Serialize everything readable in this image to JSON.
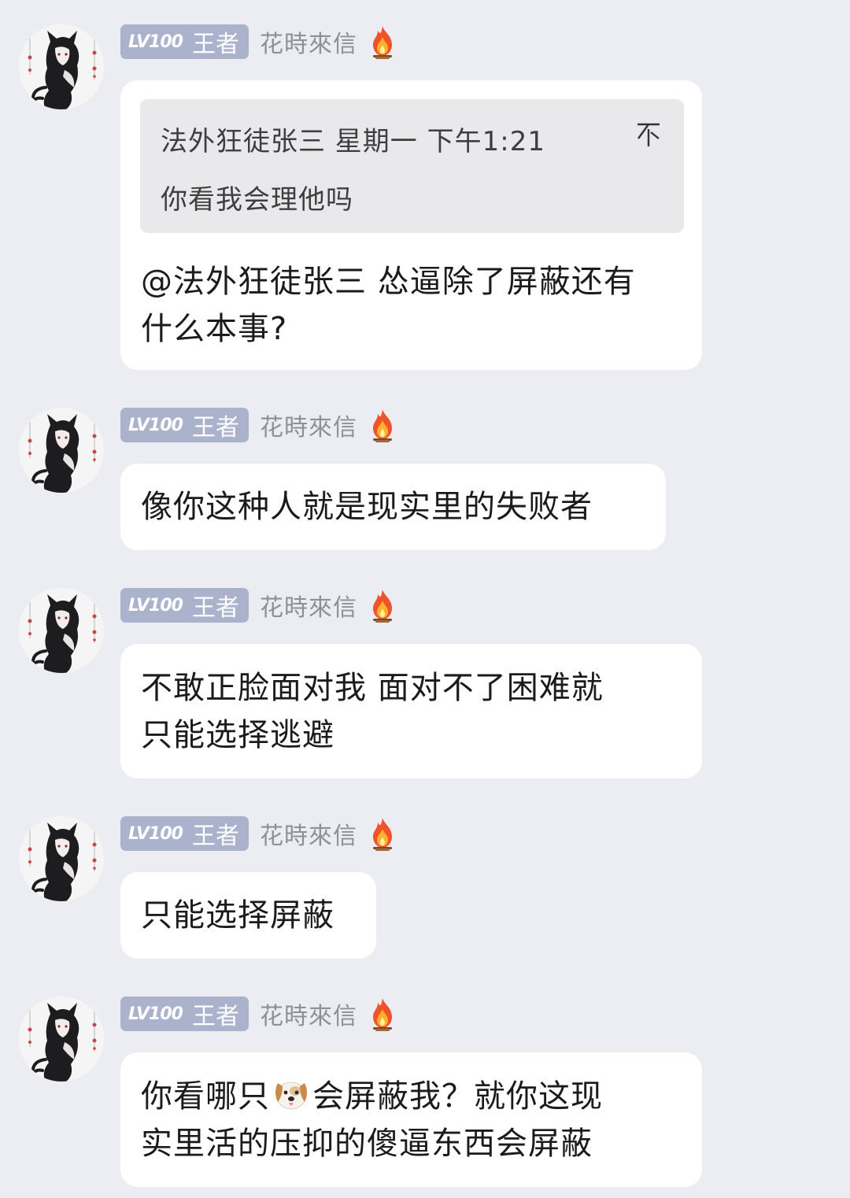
{
  "sender": {
    "level": "LV100",
    "title": "王者",
    "name": "花時來信",
    "avatar_icon": "anime-cat-girl-avatar",
    "flame_icon": "flame-icon"
  },
  "colors": {
    "background": "#ecedf2",
    "badge": "#aab2cc",
    "bubble": "#ffffff",
    "quote_bg": "#e9e9eb",
    "username": "#8f8f96"
  },
  "messages": [
    {
      "quote": {
        "header": "法外狂徒张三 星期一 下午1:21",
        "body": "你看我会理他吗"
      },
      "lines": [
        "@法外狂徒张三 怂逼除了屏蔽还有",
        "什么本事?"
      ]
    },
    {
      "lines": [
        "像你这种人就是现实里的失败者"
      ]
    },
    {
      "lines": [
        "不敢正脸面对我 面对不了困难就",
        "只能选择逃避"
      ]
    },
    {
      "lines": [
        "只能选择屏蔽"
      ]
    },
    {
      "line1_before_emoji": "你看哪只",
      "emoji": "dog-face-emoji",
      "line1_after_emoji": "会屏蔽我？就你这现",
      "line2": "实里活的压抑的傻逼东西会屏蔽"
    }
  ]
}
